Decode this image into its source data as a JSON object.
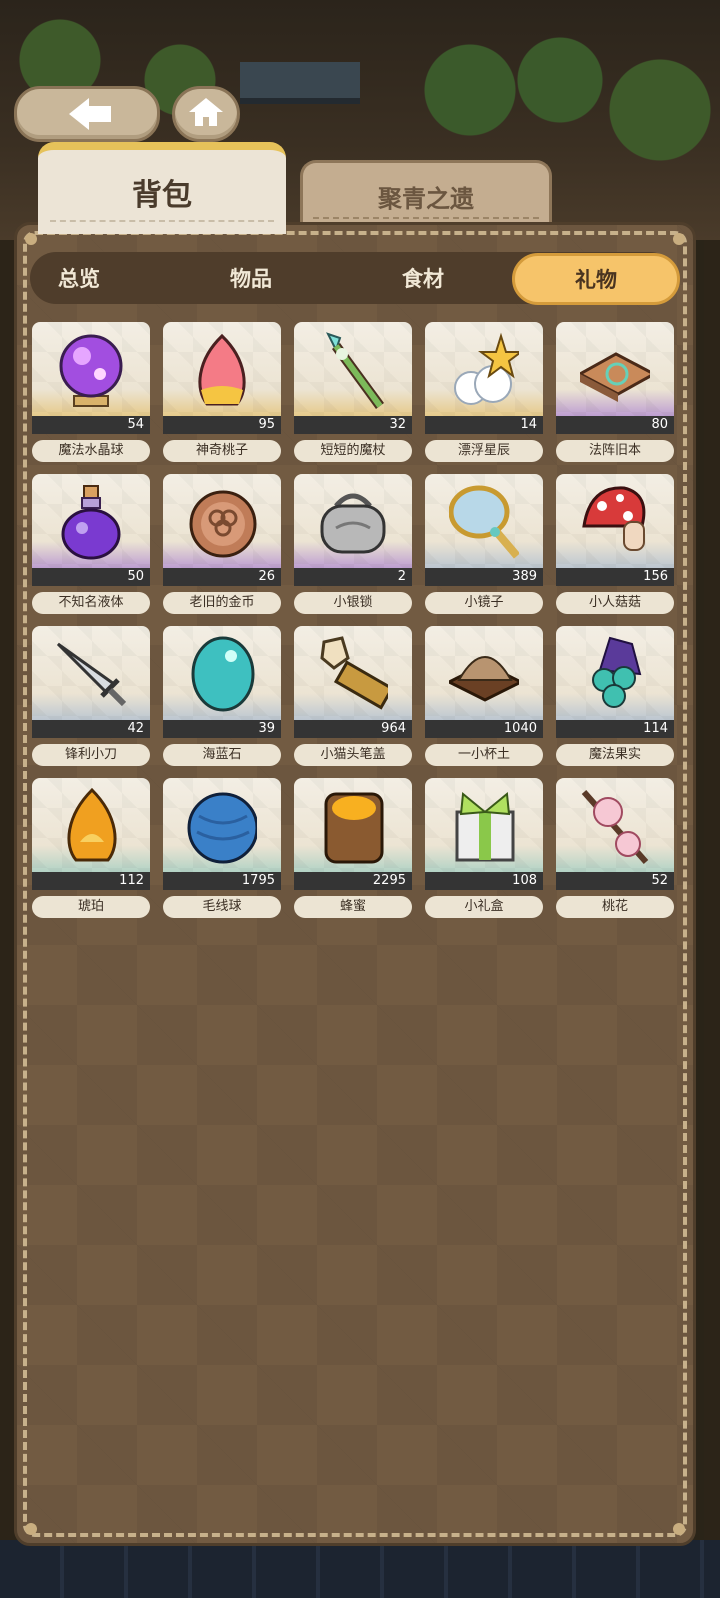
{
  "nav": {
    "back_icon": "arrow-left-icon",
    "home_icon": "home-icon"
  },
  "main_tabs": [
    {
      "label": "背包",
      "active": true
    },
    {
      "label": "聚青之遗",
      "active": false
    }
  ],
  "categories": [
    {
      "label": "总览",
      "active": false
    },
    {
      "label": "物品",
      "active": false
    },
    {
      "label": "食材",
      "active": false
    },
    {
      "label": "礼物",
      "active": true
    }
  ],
  "items": [
    {
      "name": "魔法水晶球",
      "count": "54",
      "icon": "crystal-ball-icon",
      "tint": "#e2b95a"
    },
    {
      "name": "神奇桃子",
      "count": "95",
      "icon": "peach-icon",
      "tint": "#e2b95a"
    },
    {
      "name": "短短的魔杖",
      "count": "32",
      "icon": "magic-wand-icon",
      "tint": "#e2b95a"
    },
    {
      "name": "漂浮星辰",
      "count": "14",
      "icon": "cloud-star-icon",
      "tint": "#e2b95a"
    },
    {
      "name": "法阵旧本",
      "count": "80",
      "icon": "old-book-icon",
      "tint": "#9e6fd0"
    },
    {
      "name": "不知名液体",
      "count": "50",
      "icon": "potion-icon",
      "tint": "#9e6fd0"
    },
    {
      "name": "老旧的金币",
      "count": "26",
      "icon": "coin-icon",
      "tint": "#9e6fd0"
    },
    {
      "name": "小银锁",
      "count": "2",
      "icon": "silver-lock-icon",
      "tint": "#9e6fd0"
    },
    {
      "name": "小镜子",
      "count": "389",
      "icon": "hand-mirror-icon",
      "tint": "#9cb3cf"
    },
    {
      "name": "小人菇菇",
      "count": "156",
      "icon": "mushroom-icon",
      "tint": "#9cb3cf"
    },
    {
      "name": "锋利小刀",
      "count": "42",
      "icon": "knife-icon",
      "tint": "#9cb3cf"
    },
    {
      "name": "海蓝石",
      "count": "39",
      "icon": "aquamarine-icon",
      "tint": "#9cb3cf"
    },
    {
      "name": "小猫头笔盖",
      "count": "964",
      "icon": "cat-pen-cap-icon",
      "tint": "#9cb3cf"
    },
    {
      "name": "一小杯土",
      "count": "1040",
      "icon": "soil-cup-icon",
      "tint": "#9cb3cf"
    },
    {
      "name": "魔法果实",
      "count": "114",
      "icon": "magic-fruit-icon",
      "tint": "#9cb3cf"
    },
    {
      "name": "琥珀",
      "count": "112",
      "icon": "amber-icon",
      "tint": "#8cc7bc"
    },
    {
      "name": "毛线球",
      "count": "1795",
      "icon": "yarn-ball-icon",
      "tint": "#8cc7bc"
    },
    {
      "name": "蜂蜜",
      "count": "2295",
      "icon": "honey-jar-icon",
      "tint": "#8cc7bc"
    },
    {
      "name": "小礼盒",
      "count": "108",
      "icon": "gift-box-icon",
      "tint": "#8cc7bc"
    },
    {
      "name": "桃花",
      "count": "52",
      "icon": "peach-blossom-icon",
      "tint": "#8cc7bc"
    }
  ]
}
